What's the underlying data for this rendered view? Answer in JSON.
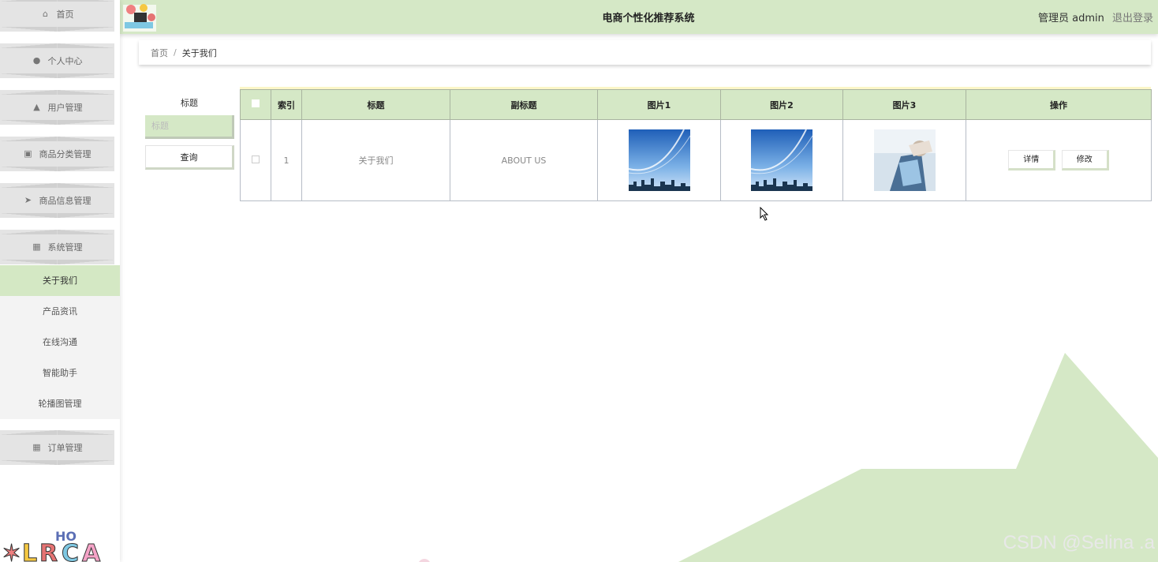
{
  "header": {
    "title": "电商个性化推荐系统",
    "role": "管理员 admin",
    "logout": "退出登录"
  },
  "sidebar": {
    "items": [
      {
        "label": "首页",
        "icon": "home-icon"
      },
      {
        "label": "个人中心",
        "icon": "user-icon"
      },
      {
        "label": "用户管理",
        "icon": "thumbs-icon"
      },
      {
        "label": "商品分类管理",
        "icon": "chart-icon"
      },
      {
        "label": "商品信息管理",
        "icon": "send-icon"
      },
      {
        "label": "系统管理",
        "icon": "grid-icon"
      },
      {
        "label": "订单管理",
        "icon": "grid-icon"
      }
    ],
    "sub_items": [
      {
        "label": "关于我们",
        "active": true
      },
      {
        "label": "产品资讯"
      },
      {
        "label": "在线沟通"
      },
      {
        "label": "智能助手"
      },
      {
        "label": "轮播图管理"
      }
    ]
  },
  "breadcrumb": {
    "home": "首页",
    "separator": "/",
    "current": "关于我们"
  },
  "search": {
    "label": "标题",
    "placeholder": "标题",
    "button": "查询"
  },
  "table": {
    "headers": [
      "索引",
      "标题",
      "副标题",
      "图片1",
      "图片2",
      "图片3",
      "操作"
    ],
    "rows": [
      {
        "index": "1",
        "title": "关于我们",
        "subtitle": "ABOUT US",
        "detail": "详情",
        "edit": "修改"
      }
    ]
  },
  "watermark": "CSDN @Selina .a",
  "colors": {
    "accent": "#d5e8c6",
    "active_sub": "#d4e8c4",
    "menu_bg": "#e4e4e4"
  }
}
